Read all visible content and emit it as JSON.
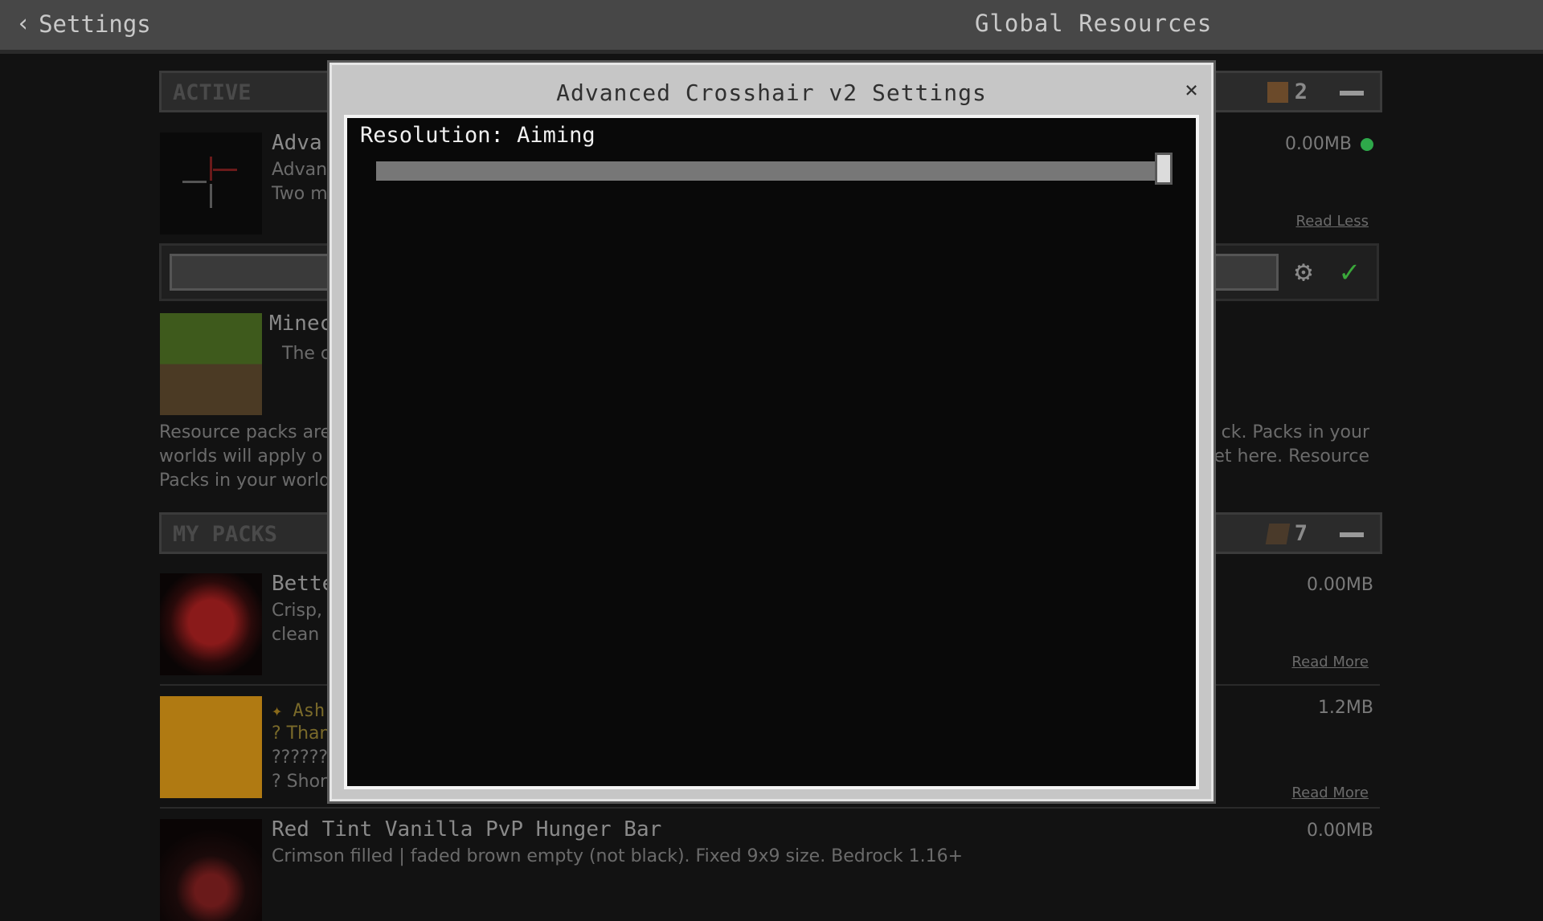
{
  "topbar": {
    "back_label": "Settings",
    "title": "Global Resources"
  },
  "active_section": {
    "label": "ACTIVE",
    "count": "2"
  },
  "active_pack": {
    "name": "Adva",
    "line1": "Advan",
    "line2": "Two m",
    "size": "0.00MB",
    "link": "Read Less"
  },
  "minecraft_pack": {
    "name": "Minec",
    "line1": "The c"
  },
  "info": {
    "line1_left": "Resource packs are",
    "line1_right": "ck. Packs in your",
    "line2_left": "worlds will apply o",
    "line2_right": "et here. Resource",
    "line3_left": "Packs in your world"
  },
  "my_packs_section": {
    "label": "MY PACKS",
    "count": "7"
  },
  "packs": [
    {
      "name": "Bette",
      "line1": "Crisp,",
      "line2": "clean",
      "size": "0.00MB",
      "link": "Read More"
    },
    {
      "name": "Ash",
      "line1": "? Than",
      "line2": "??????",
      "line3": "? Shor",
      "size": "1.2MB",
      "link": "Read More"
    },
    {
      "name": "Red Tint Vanilla PvP Hunger Bar",
      "line1": "Crimson filled | faded brown empty (not black). Fixed 9x9 size. Bedrock 1.16+",
      "size": "0.00MB"
    }
  ],
  "modal": {
    "title": "Advanced Crosshair v2 Settings",
    "close": "×",
    "setting_label": "Resolution: Aiming",
    "slider_value": 1.0
  },
  "colors": {
    "status_green": "#2ea84a",
    "check_green": "#3aa83a"
  }
}
